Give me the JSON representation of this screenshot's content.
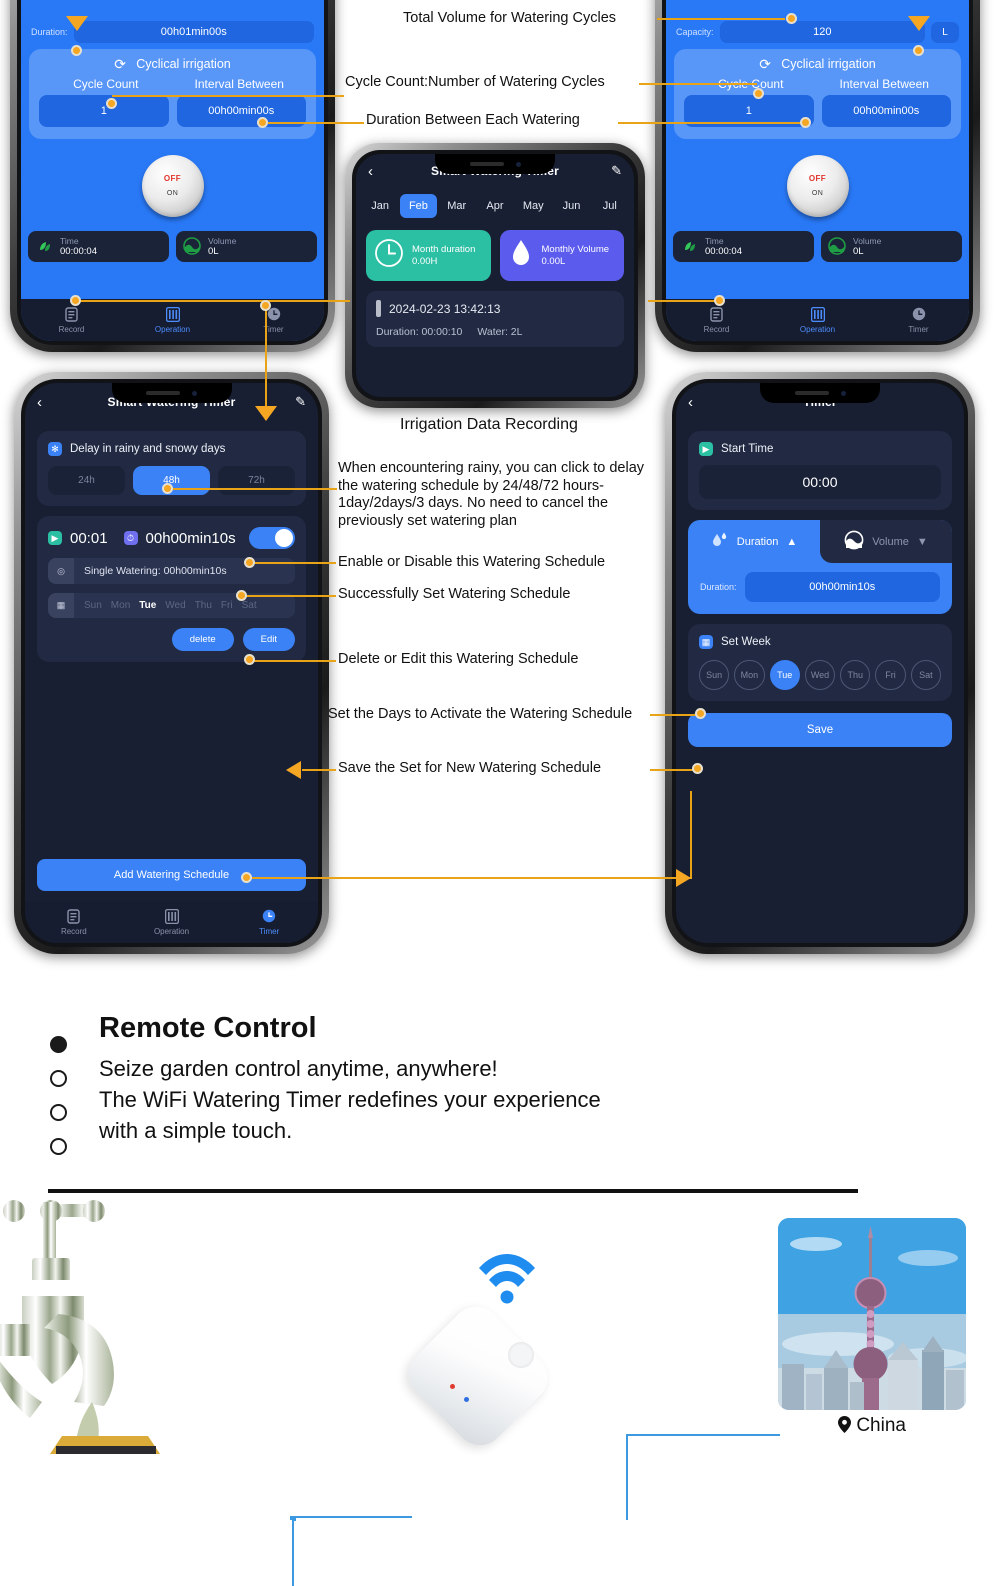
{
  "top_left_phone": {
    "duration_label": "Duration:",
    "duration_value": "00h01min00s",
    "cyclical_title": "Cyclical irrigation",
    "cycle_count_label": "Cycle Count",
    "interval_label": "Interval Between",
    "cycle_count_value": "1",
    "interval_value": "00h00min00s",
    "knob_off": "OFF",
    "knob_on": "ON",
    "stat_time_label": "Time",
    "stat_time_value": "00:00:04",
    "stat_volume_label": "Volume",
    "stat_volume_value": "0L",
    "tabs": [
      {
        "label": "Record",
        "icon": "record-icon",
        "active": false
      },
      {
        "label": "Operation",
        "icon": "operation-icon",
        "active": true
      },
      {
        "label": "Timer",
        "icon": "timer-icon",
        "active": false
      }
    ]
  },
  "top_right_phone": {
    "capacity_label": "Capacity:",
    "capacity_value": "120",
    "capacity_unit": "L",
    "cyclical_title": "Cyclical irrigation",
    "cycle_count_label": "Cycle Count",
    "interval_label": "Interval Between",
    "cycle_count_value": "1",
    "interval_value": "00h00min00s",
    "knob_off": "OFF",
    "knob_on": "ON",
    "stat_time_label": "Time",
    "stat_time_value": "00:00:04",
    "stat_volume_label": "Volume",
    "stat_volume_value": "0L",
    "tabs": [
      {
        "label": "Record",
        "active": false
      },
      {
        "label": "Operation",
        "active": true
      },
      {
        "label": "Timer",
        "active": false
      }
    ]
  },
  "middle_phone": {
    "title": "Smart Watering Timer",
    "months": [
      "Jan",
      "Feb",
      "Mar",
      "Apr",
      "May",
      "Jun",
      "Jul"
    ],
    "selected_month": "Feb",
    "month_duration_label": "Month duration",
    "month_duration_value": "0.00H",
    "monthly_volume_label": "Monthly Volume",
    "monthly_volume_value": "0.00L",
    "record_datetime": "2024-02-23 13:42:13",
    "record_duration": "Duration: 00:00:10",
    "record_water": "Water: 2L",
    "caption": "Irrigation Data Recording"
  },
  "bottom_left_phone": {
    "title": "Smart Watering Timer",
    "delay_title": "Delay in rainy and snowy days",
    "delay_options": [
      "24h",
      "48h",
      "72h"
    ],
    "delay_selected": "48h",
    "schedule_time": "00:01",
    "schedule_duration": "00h00min10s",
    "schedule_mode": "Single Watering: 00h00min10s",
    "days": [
      "Sun",
      "Mon",
      "Tue",
      "Wed",
      "Thu",
      "Fri",
      "Sat"
    ],
    "active_days": [
      "Tue"
    ],
    "delete_label": "delete",
    "edit_label": "Edit",
    "add_label": "Add Watering Schedule",
    "tabs": [
      {
        "label": "Record",
        "active": false
      },
      {
        "label": "Operation",
        "active": false
      },
      {
        "label": "Timer",
        "active": true
      }
    ]
  },
  "bottom_right_phone": {
    "title": "Timer",
    "start_time_label": "Start Time",
    "start_time_value": "00:00",
    "tab_duration": "Duration",
    "tab_volume": "Volume",
    "duration_label": "Duration:",
    "duration_value": "00h00min10s",
    "set_week_label": "Set Week",
    "days": [
      "Sun",
      "Mon",
      "Tue",
      "Wed",
      "Thu",
      "Fri",
      "Sat"
    ],
    "selected_day": "Tue",
    "save_label": "Save"
  },
  "annotations": {
    "a1": "Total Volume for Watering Cycles",
    "a2": "Cycle Count:Number of Watering Cycles",
    "a3": "Duration Between Each Watering",
    "a4": "When encountering rainy, you can click to delay the watering schedule by 24/48/72 hours-1day/2days/3 days. No need to cancel the previously set watering plan",
    "a5": "Enable or Disable this Watering Schedule",
    "a6": "Successfully Set Watering Schedule",
    "a7": "Delete or Edit this Watering Schedule",
    "a8": "Set the Days to Activate the Watering Schedule",
    "a9": "Save the Set for New Watering Schedule"
  },
  "marketing": {
    "title": "Remote Control",
    "line1": "Seize garden control anytime, anywhere!",
    "line2": "The WiFi Watering Timer redefines your experience",
    "line3": "with a simple touch."
  },
  "hero": {
    "location_label": "China",
    "location_icon": "map-pin-icon",
    "wifi_icon": "wifi-icon",
    "hub_icon": "wifi-gateway-hub"
  },
  "colors": {
    "accent_orange": "#F5A623",
    "blue": "#3b82f6",
    "op_blue": "#2979f7",
    "dark": "#181f33",
    "green": "#2bbfa3",
    "purple": "#5b5bee"
  }
}
